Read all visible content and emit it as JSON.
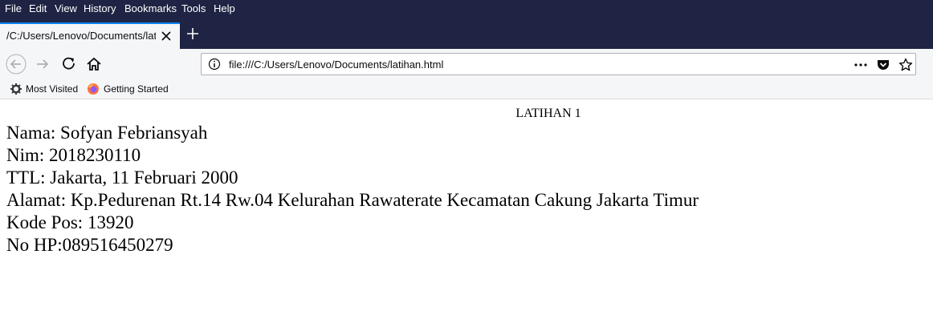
{
  "menu": {
    "file": "File",
    "edit": "Edit",
    "view": "View",
    "history": "History",
    "bookmarks": "Bookmarks",
    "tools": "Tools",
    "help": "Help"
  },
  "tab": {
    "title": "/C:/Users/Lenovo/Documents/latihan.html"
  },
  "urlbar": {
    "url": "file:///C:/Users/Lenovo/Documents/latihan.html"
  },
  "bookmarks": {
    "most_visited": "Most Visited",
    "getting_started": "Getting Started"
  },
  "page": {
    "heading": "LATIHAN 1",
    "lines": [
      "Nama: Sofyan Febriansyah",
      "Nim: 2018230110",
      "TTL: Jakarta, 11 Februari 2000",
      "Alamat: Kp.Pedurenan Rt.14 Rw.04 Kelurahan Rawaterate Kecamatan Cakung Jakarta Timur",
      "Kode Pos: 13920",
      "No HP:089516450279"
    ]
  },
  "colors": {
    "chrome_dark": "#1f2444",
    "toolbar": "#f5f6f7",
    "tab_accent": "#0a84ff"
  },
  "icons": [
    "close-icon",
    "plus-icon",
    "back-arrow-icon",
    "forward-arrow-icon",
    "reload-icon",
    "home-icon",
    "info-icon",
    "more-actions-icon",
    "pocket-icon",
    "star-icon",
    "gear-icon",
    "firefox-icon"
  ]
}
